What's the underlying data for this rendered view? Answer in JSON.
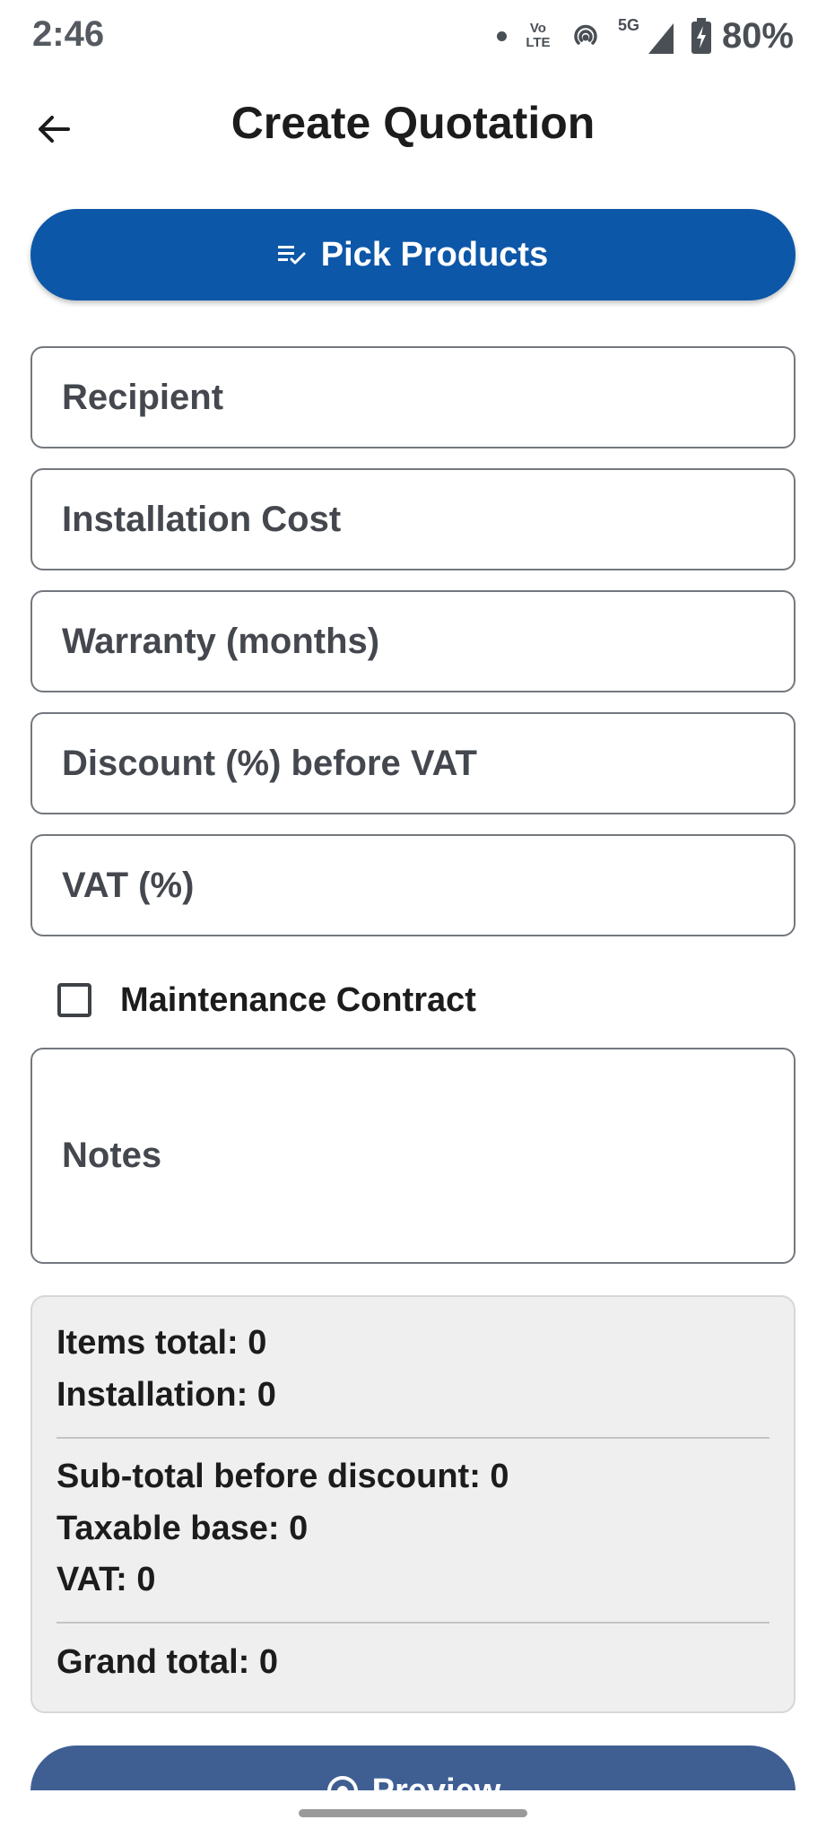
{
  "status_bar": {
    "time": "2:46",
    "volte_top": "Vo",
    "volte_bottom": "LTE",
    "network": "5G",
    "battery": "80%"
  },
  "app_bar": {
    "title": "Create Quotation",
    "back_icon": "arrow-back-icon"
  },
  "pick_products": {
    "label": "Pick Products",
    "icon": "checklist-icon",
    "color": "#0d57a8"
  },
  "form": {
    "recipient_placeholder": "Recipient",
    "installation_cost_placeholder": "Installation Cost",
    "warranty_placeholder": "Warranty (months)",
    "discount_placeholder": "Discount (%) before VAT",
    "vat_placeholder": "VAT (%)",
    "maintenance_contract_label": "Maintenance Contract",
    "maintenance_contract_checked": false,
    "notes_placeholder": "Notes"
  },
  "summary": {
    "items_total": "Items total: 0",
    "installation": "Installation: 0",
    "subtotal": "Sub-total before discount: 0",
    "taxable_base": "Taxable base: 0",
    "vat": "VAT: 0",
    "grand_total": "Grand total: 0"
  },
  "preview": {
    "label": "Preview",
    "icon": "eye-icon",
    "color": "#3f5f93"
  }
}
